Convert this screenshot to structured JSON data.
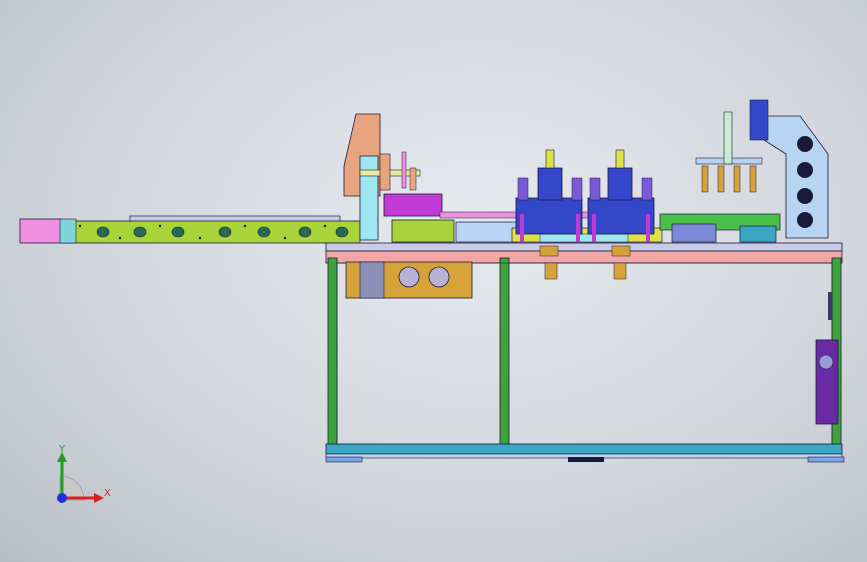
{
  "viewport": {
    "background_color": "#d6d9de"
  },
  "model": {
    "colors": {
      "outline": "#1a1a3a",
      "frame_leg": "#3ea33a",
      "frame_beam_top": "#f2a6a6",
      "frame_beam_bottom": "#3aa6c4",
      "table_top": "#c9cbe6",
      "conveyor": "#a8d43a",
      "conveyor_end": "#ee8fe0",
      "gantry_tan": "#e8a47e",
      "gantry_cyan": "#9fe7f0",
      "press_blue": "#3446c9",
      "press_yellow": "#e0e14a",
      "bracket_lightblue": "#b7d4f2",
      "plate_gold": "#d6a23a",
      "cabinet_purple": "#6a2aa6",
      "accent_magenta": "#c13ad6",
      "accent_green": "#4ac04a"
    }
  },
  "triad": {
    "x_label": "X",
    "y_label": "Y",
    "x_color": "#e02020",
    "y_color": "#20a020",
    "z_color": "#2030e0"
  }
}
